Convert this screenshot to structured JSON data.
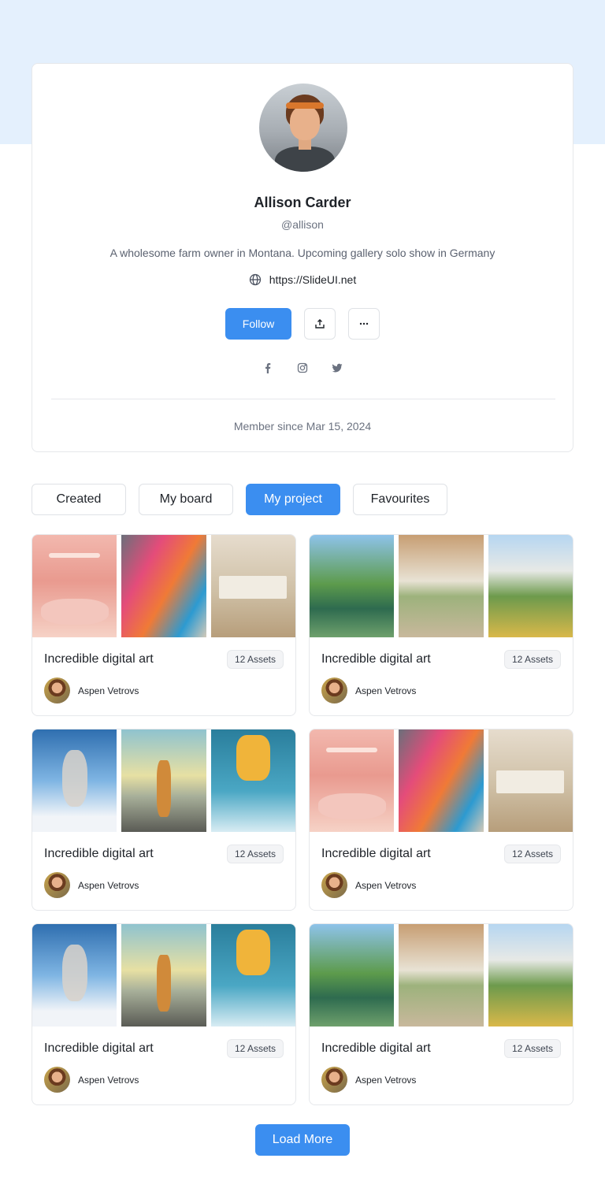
{
  "profile": {
    "name": "Allison Carder",
    "handle": "@allison",
    "bio": "A wholesome farm owner in Montana. Upcoming gallery solo show in Germany",
    "website": "https://SlideUI.net",
    "member_since": "Member since Mar 15, 2024",
    "follow_label": "Follow"
  },
  "socials": [
    "facebook-icon",
    "instagram-icon",
    "twitter-icon"
  ],
  "tabs": [
    {
      "label": "Created",
      "active": false
    },
    {
      "label": "My board",
      "active": false
    },
    {
      "label": "My project",
      "active": true
    },
    {
      "label": "Favourites",
      "active": false
    }
  ],
  "projects": [
    {
      "title": "Incredible digital art",
      "assets": "12 Assets",
      "author": "Aspen Vetrovs",
      "thumbs": [
        "pink",
        "bags",
        "interior"
      ]
    },
    {
      "title": "Incredible digital art",
      "assets": "12 Assets",
      "author": "Aspen Vetrovs",
      "thumbs": [
        "pond",
        "room",
        "garden"
      ]
    },
    {
      "title": "Incredible digital art",
      "assets": "12 Assets",
      "author": "Aspen Vetrovs",
      "thumbs": [
        "sky1",
        "road",
        "sky2"
      ]
    },
    {
      "title": "Incredible digital art",
      "assets": "12 Assets",
      "author": "Aspen Vetrovs",
      "thumbs": [
        "pink",
        "bags",
        "interior"
      ]
    },
    {
      "title": "Incredible digital art",
      "assets": "12 Assets",
      "author": "Aspen Vetrovs",
      "thumbs": [
        "sky1",
        "road",
        "sky2"
      ]
    },
    {
      "title": "Incredible digital art",
      "assets": "12 Assets",
      "author": "Aspen Vetrovs",
      "thumbs": [
        "pond",
        "room",
        "garden"
      ]
    }
  ],
  "load_more_label": "Load More",
  "colors": {
    "accent": "#3b8ef0",
    "band": "#e4f0fd"
  }
}
